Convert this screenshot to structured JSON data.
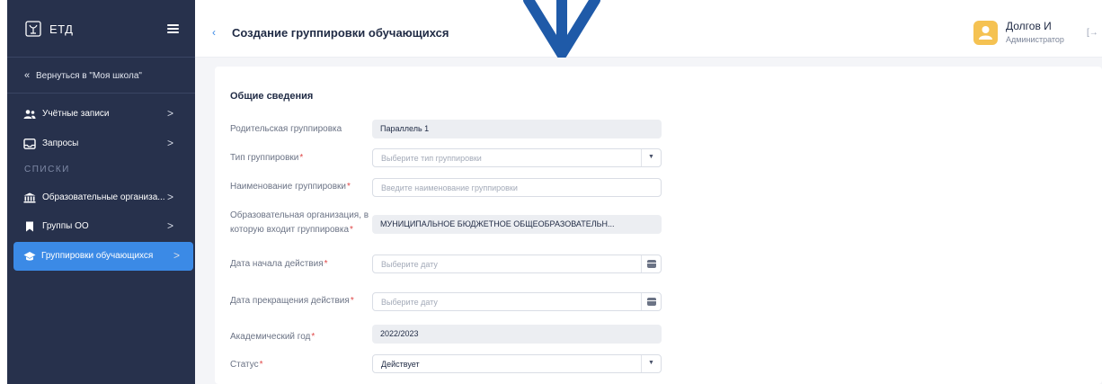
{
  "app": {
    "logo_text": "ЕТД"
  },
  "sidebar": {
    "back_label": "Вернуться в \"Моя школа\"",
    "section_label": "СПИСКИ",
    "items": [
      {
        "label": "Учётные записи"
      },
      {
        "label": "Запросы"
      },
      {
        "label": "Образовательные организа..."
      },
      {
        "label": "Группы ОО"
      },
      {
        "label": "Группировки обучающихся"
      }
    ],
    "arrow": ">",
    "back_chevron": "«"
  },
  "topbar": {
    "back_chevron": "‹",
    "title": "Создание группировки обучающихся",
    "user_name": "Долгов И",
    "user_role": "Администратор",
    "logout_glyph": "[→"
  },
  "form": {
    "section_title": "Общие сведения",
    "required_mark": "*",
    "dropdown_glyph": "▼",
    "fields": [
      {
        "label": "Родительская группировка",
        "value": "Параллель 1"
      },
      {
        "label": "Тип группировки",
        "placeholder": "Выберите тип группировки"
      },
      {
        "label": "Наименование группировки",
        "placeholder": "Введите наименование группировки"
      },
      {
        "label": "Образовательная организация, в которую входит группировка",
        "value": "МУНИЦИПАЛЬНОЕ БЮДЖЕТНОЕ ОБЩЕОБРАЗОВАТЕЛЬН..."
      },
      {
        "label": "Дата начала действия",
        "placeholder": "Выберите дату"
      },
      {
        "label": "Дата прекращения действия",
        "placeholder": "Выберите дату"
      },
      {
        "label": "Академический год",
        "value": "2022/2023"
      },
      {
        "label": "Статус",
        "value": "Действует"
      }
    ]
  },
  "colors": {
    "sidebar_bg": "#27314c",
    "accent": "#3b8ae6",
    "annotation_arrow": "#1f5aa8",
    "avatar": "#f5c252",
    "required": "#e04848"
  }
}
